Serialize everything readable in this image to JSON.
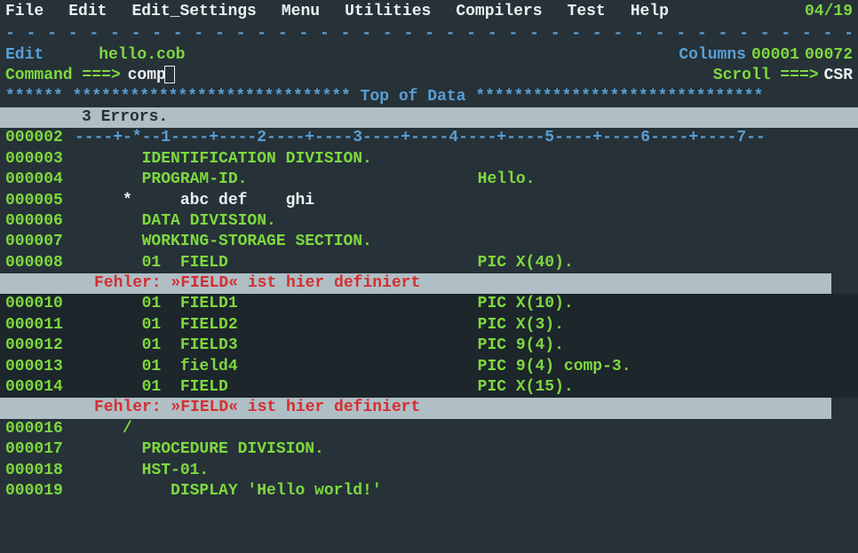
{
  "menu": {
    "items": [
      "File",
      "Edit",
      "Edit_Settings",
      "Menu",
      "Utilities",
      "Compilers",
      "Test",
      "Help"
    ],
    "date": "04/19"
  },
  "divider": "- - - - - - - - - - - - - - - - - - - - - - - - - - - - - - - - - - - - - - - - - - - - - - - - - - - - - - - - - - -",
  "header": {
    "mode": "Edit",
    "filename": "hello.cob",
    "cols_label": "Columns",
    "col_start": "00001",
    "col_end": "00072"
  },
  "command": {
    "label": "Command ===>",
    "value": "comp",
    "scroll_label": "Scroll  ===>",
    "scroll_value": "CSR"
  },
  "top_of_data": "****** ***************************** Top of Data ******************************",
  "errors_summary": "3 Errors.",
  "ruler": "----+-*--1----+----2----+----3----+----4----+----5----+----6----+----7--",
  "lines": [
    {
      "num": "000002",
      "type": "ruler"
    },
    {
      "num": "000003",
      "type": "code",
      "text": "       IDENTIFICATION DIVISION."
    },
    {
      "num": "000004",
      "type": "code",
      "text": "       PROGRAM-ID.                        Hello."
    },
    {
      "num": "000005",
      "type": "code-white",
      "text": "     *     abc def    ghi"
    },
    {
      "num": "000006",
      "type": "code",
      "text": "       DATA DIVISION."
    },
    {
      "num": "000007",
      "type": "code",
      "text": "       WORKING-STORAGE SECTION."
    },
    {
      "num": "000008",
      "type": "code",
      "text": "       01  FIELD                          PIC X(40)."
    }
  ],
  "error1": "Fehler: »FIELD« ist hier definiert",
  "lines2": [
    {
      "num": "000010",
      "type": "code",
      "text": "       01  FIELD1                         PIC X(10)."
    },
    {
      "num": "000011",
      "type": "code",
      "text": "       01  FIELD2                         PIC X(3)."
    },
    {
      "num": "000012",
      "type": "code",
      "text": "       01  FIELD3                         PIC 9(4)."
    },
    {
      "num": "000013",
      "type": "code",
      "text": "       01  field4                         PIC 9(4) comp-3."
    },
    {
      "num": "000014",
      "type": "code",
      "text": "       01  FIELD                          PIC X(15)."
    }
  ],
  "error2": "Fehler: »FIELD« ist hier definiert",
  "lines3": [
    {
      "num": "000016",
      "type": "code",
      "text": "     /"
    },
    {
      "num": "000017",
      "type": "code",
      "text": "       PROCEDURE DIVISION."
    },
    {
      "num": "000018",
      "type": "code",
      "text": "       HST-01."
    },
    {
      "num": "000019",
      "type": "code",
      "text": "          DISPLAY 'Hello world!'"
    }
  ]
}
